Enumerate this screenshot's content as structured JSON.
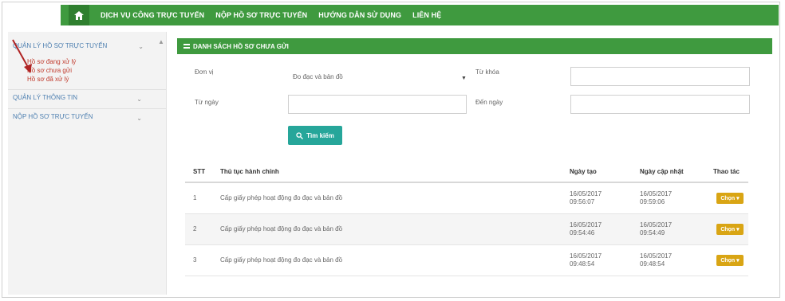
{
  "topnav": {
    "items": [
      "DỊCH VỤ CÔNG TRỰC TUYẾN",
      "NỘP HỒ SƠ TRỰC TUYẾN",
      "HƯỚNG DẪN SỬ DỤNG",
      "LIÊN HỆ"
    ]
  },
  "sidebar": {
    "group1": "QUẢN LÝ HỒ SƠ TRỰC TUYẾN",
    "group1_items": [
      "Hồ sơ đang xử lý",
      "Hồ sơ chưa gửi",
      "Hồ sơ đã xử lý"
    ],
    "group2": "QUẢN LÝ THÔNG TIN",
    "group3": "NỘP HỒ SƠ TRỰC TUYẾN"
  },
  "panel": {
    "title": "DANH SÁCH HỒ SƠ CHƯA GỬI",
    "don_vi_label": "Đơn vị",
    "don_vi_value": "Đo đạc và bản đồ",
    "tu_khoa_label": "Từ khóa",
    "tu_ngay_label": "Từ ngày",
    "den_ngay_label": "Đến ngày",
    "search_button": "Tìm kiếm"
  },
  "table": {
    "headers": [
      "STT",
      "Thủ tục hành chính",
      "Ngày tạo",
      "Ngày cập nhật",
      "Thao tác"
    ],
    "rows": [
      {
        "stt": "1",
        "thu_tuc": "Cấp giấy phép hoạt động đo đạc và bản đồ",
        "ngay_tao_date": "16/05/2017",
        "ngay_tao_time": "09:56:07",
        "ngay_cap_nhat_date": "16/05/2017",
        "ngay_cap_nhat_time": "09:59:06",
        "action": "Chọn"
      },
      {
        "stt": "2",
        "thu_tuc": "Cấp giấy phép hoạt động đo đạc và bản đồ",
        "ngay_tao_date": "16/05/2017",
        "ngay_tao_time": "09:54:46",
        "ngay_cap_nhat_date": "16/05/2017",
        "ngay_cap_nhat_time": "09:54:49",
        "action": "Chọn"
      },
      {
        "stt": "3",
        "thu_tuc": "Cấp giấy phép hoạt động đo đạc và bản đồ",
        "ngay_tao_date": "16/05/2017",
        "ngay_tao_time": "09:48:54",
        "ngay_cap_nhat_date": "16/05/2017",
        "ngay_cap_nhat_time": "09:48:54",
        "action": "Chọn"
      }
    ]
  },
  "colors": {
    "nav_green": "#3f9a3f",
    "search_teal": "#26a69a",
    "action_gold": "#d9a514",
    "highlight_red": "#c0392b"
  }
}
